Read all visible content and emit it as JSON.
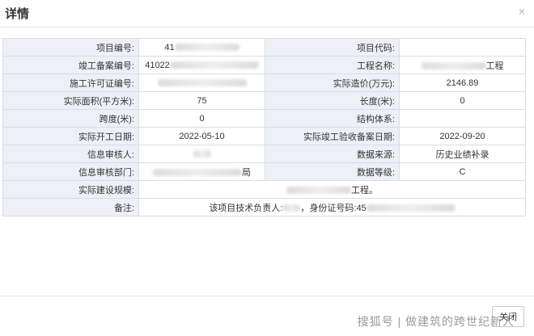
{
  "dialog": {
    "title": "详情",
    "close_glyph": "×"
  },
  "rows": [
    {
      "l1": "项目编号:",
      "v1": "41",
      "l2": "项目代码:",
      "v2": ""
    },
    {
      "l1": "竣工备案编号:",
      "v1": "41022",
      "l2": "工程名称:",
      "v2": "工程"
    },
    {
      "l1": "施工许可证编号:",
      "v1": "",
      "l2": "实际造价(万元):",
      "v2": "2146.89"
    },
    {
      "l1": "实际面积(平方米):",
      "v1": "75",
      "l2": "长度(米):",
      "v2": "0"
    },
    {
      "l1": "跨度(米):",
      "v1": "0",
      "l2": "结构体系:",
      "v2": ""
    },
    {
      "l1": "实际开工日期:",
      "v1": "2022-05-10",
      "l2": "实际竣工验收备案日期:",
      "v2": "2022-09-20"
    },
    {
      "l1": "信息审核人:",
      "v1": "",
      "l2": "数据来源:",
      "v2": "历史业绩补录"
    },
    {
      "l1": "信息审核部门:",
      "v1": "局",
      "l2": "数据等级:",
      "v2": "C"
    }
  ],
  "scale": {
    "label": "实际建设规模:",
    "value": "工程。"
  },
  "remark": {
    "label": "备注:",
    "prefix": "该项目技术负责人:",
    "id_label": "身份证号码:",
    "id_value": "45"
  },
  "footer": {
    "close_label": "关闭"
  },
  "watermark": "搜狐号 | 做建筑的跨世纪新人"
}
